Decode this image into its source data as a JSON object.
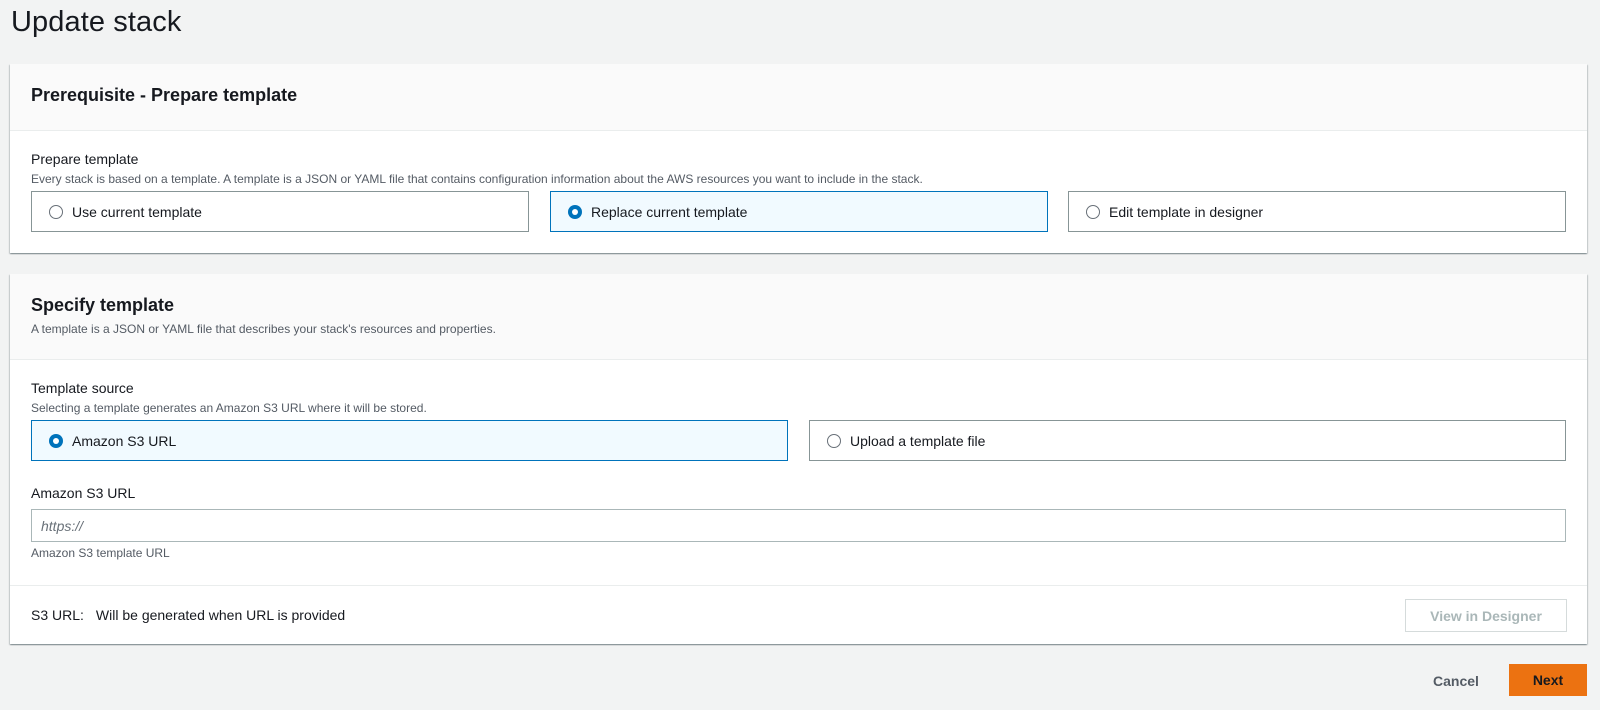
{
  "page": {
    "title": "Update stack"
  },
  "prerequisite": {
    "title": "Prerequisite - Prepare template",
    "field_label": "Prepare template",
    "field_desc": "Every stack is based on a template. A template is a JSON or YAML file that contains configuration information about the AWS resources you want to include in the stack.",
    "options": [
      {
        "label": "Use current template",
        "selected": false
      },
      {
        "label": "Replace current template",
        "selected": true
      },
      {
        "label": "Edit template in designer",
        "selected": false
      }
    ]
  },
  "specify": {
    "title": "Specify template",
    "desc": "A template is a JSON or YAML file that describes your stack's resources and properties.",
    "source_label": "Template source",
    "source_desc": "Selecting a template generates an Amazon S3 URL where it will be stored.",
    "options": [
      {
        "label": "Amazon S3 URL",
        "selected": true
      },
      {
        "label": "Upload a template file",
        "selected": false
      }
    ],
    "url_label": "Amazon S3 URL",
    "url_placeholder": "https://",
    "url_value": "",
    "url_hint": "Amazon S3 template URL",
    "footer_key": "S3 URL:",
    "footer_value": "Will be generated when URL is provided",
    "view_designer_label": "View in Designer"
  },
  "actions": {
    "cancel_label": "Cancel",
    "next_label": "Next"
  },
  "colors": {
    "accent": "#0073bb",
    "primary_button": "#ec7211",
    "selected_tile_bg": "#f1faff",
    "page_bg": "#f2f3f3"
  }
}
